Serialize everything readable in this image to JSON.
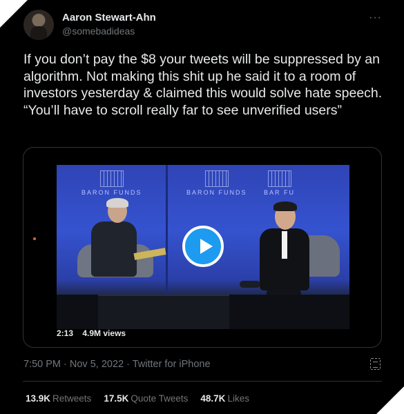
{
  "author": {
    "name": "Aaron Stewart-Ahn",
    "handle": "@somebadideas"
  },
  "menu": {
    "more_label": "···"
  },
  "tweet": {
    "text": "If you don’t pay the $8 your tweets will be suppressed by an algorithm. Not making this shit up he said it to a room of investors yesterday & claimed this would solve hate speech. “You’ll have to scroll really far to see unverified users”"
  },
  "video": {
    "duration": "2:13",
    "views": "4.9M views",
    "logo_text_1": "BARON FUNDS",
    "logo_text_2": "BARON FUNDS",
    "logo_text_3": "BAR FU",
    "icon": "play-icon",
    "accent": "#1d9bf0"
  },
  "meta": {
    "timestamp": "7:50 PM · Nov 5, 2022 · Twitter for iPhone"
  },
  "stats": [
    {
      "count": "13.9K",
      "label": "Retweets"
    },
    {
      "count": "17.5K",
      "label": "Quote Tweets"
    },
    {
      "count": "48.7K",
      "label": "Likes"
    }
  ],
  "colors": {
    "background": "#000000",
    "text": "#e7e9ea",
    "muted": "#71767b",
    "border": "#2f3336"
  }
}
